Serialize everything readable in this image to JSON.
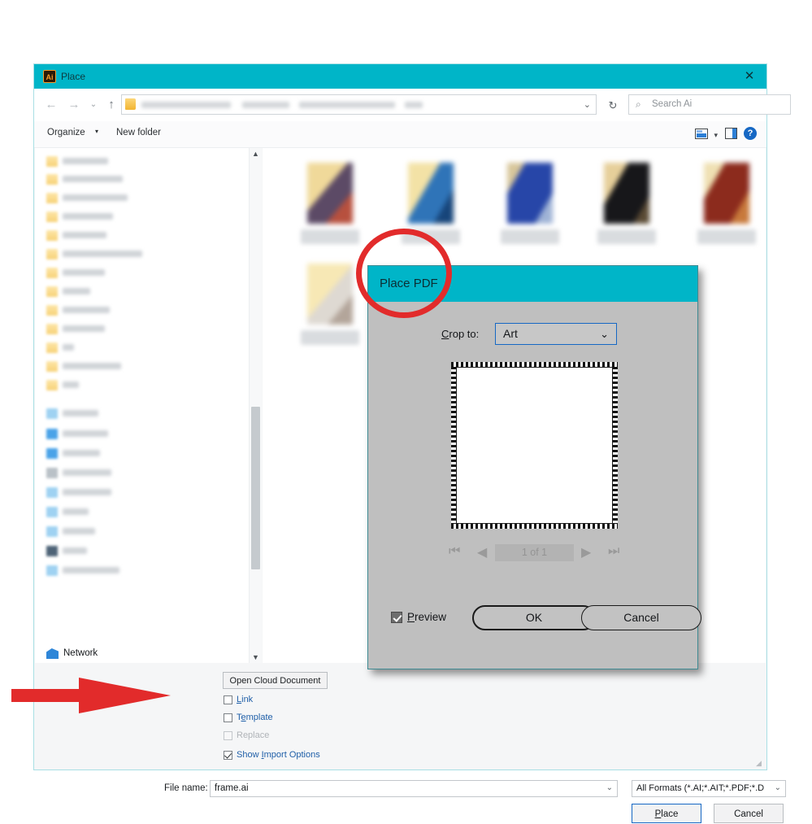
{
  "window": {
    "title": "Place",
    "app_icon": "Ai",
    "close_icon": "✕"
  },
  "nav": {
    "back_icon": "←",
    "forward_icon": "→",
    "recent_icon": "⌄",
    "up_icon": "↑",
    "address_caret": "⌄",
    "refresh_icon": "↻",
    "search_icon": "⌕",
    "search_placeholder": "Search Ai"
  },
  "commandbar": {
    "organize_label": "Organize",
    "organize_caret": "▾",
    "new_folder_label": "New folder",
    "view_caret": "▾",
    "help_label": "?"
  },
  "tree": {
    "network_label": "Network",
    "scroll_up": "▲",
    "scroll_down": "▼"
  },
  "options": {
    "open_cloud_document": "Open Cloud Document",
    "items": [
      {
        "label": "Link",
        "mnemonic": "L",
        "checked": false,
        "disabled": false
      },
      {
        "label": "Template",
        "mnemonic": "T",
        "checked": false,
        "disabled": false
      },
      {
        "label": "Replace",
        "mnemonic": "",
        "checked": false,
        "disabled": true
      },
      {
        "label": "Show Import Options",
        "mnemonic": "I",
        "checked": true,
        "disabled": false
      }
    ]
  },
  "footer": {
    "filename_label": "File name:",
    "filename_value": "frame.ai",
    "filename_caret": "⌄",
    "filetype_value": "All Formats (*.AI;*.AIT;*.PDF;*.D",
    "filetype_caret": "⌄",
    "place_label": "Place",
    "cancel_label": "Cancel",
    "resize_grip": "◢"
  },
  "pdf_dialog": {
    "title": "Place PDF",
    "crop_label": "Crop to:",
    "crop_value": "Art",
    "crop_caret": "⌄",
    "pager": {
      "first_icon": "⏮",
      "prev_icon": "◀",
      "value": "1 of 1",
      "next_icon": "▶",
      "last_icon": "⏭"
    },
    "preview_checkbox_label": "Preview",
    "preview_checked": true,
    "ok_label": "OK",
    "cancel_label": "Cancel"
  },
  "colors": {
    "accent_teal": "#00b5c8",
    "annotation_red": "#e22b2b",
    "dialog_gray": "#bfbfbf",
    "link_blue": "#1f5fa8"
  }
}
